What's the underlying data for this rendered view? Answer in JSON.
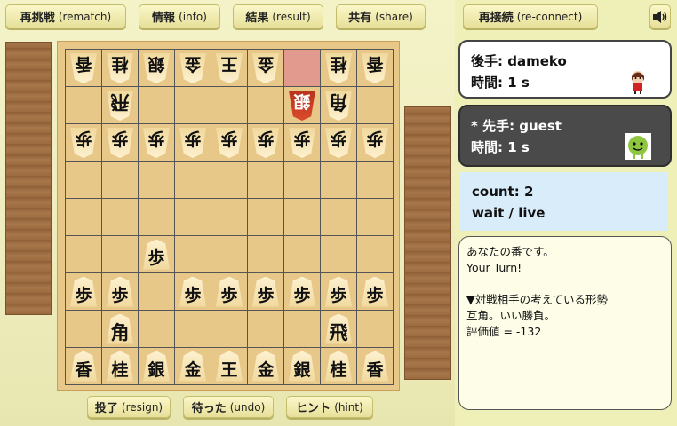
{
  "top_buttons": [
    {
      "jp": "再挑戦",
      "en": "(rematch)"
    },
    {
      "jp": "情報",
      "en": "(info)"
    },
    {
      "jp": "結果",
      "en": "(result)"
    },
    {
      "jp": "共有",
      "en": "(share)"
    },
    {
      "jp": "再接続",
      "en": "(re-connect)"
    }
  ],
  "bottom_buttons": [
    {
      "jp": "投了",
      "en": "(resign)"
    },
    {
      "jp": "待った",
      "en": "(undo)"
    },
    {
      "jp": "ヒント",
      "en": "(hint)"
    }
  ],
  "board": {
    "rows": [
      [
        "香",
        "桂",
        "銀",
        "金",
        "王",
        "金",
        "",
        "桂",
        "香"
      ],
      [
        "",
        "飛",
        "",
        "",
        "",
        "",
        "銀",
        "角",
        ""
      ],
      [
        "歩",
        "歩",
        "歩",
        "歩",
        "歩",
        "歩",
        "歩",
        "歩",
        "歩"
      ],
      [
        "",
        "",
        "",
        "",
        "",
        "",
        "",
        "",
        ""
      ],
      [
        "",
        "",
        "",
        "",
        "",
        "",
        "",
        "",
        ""
      ],
      [
        "",
        "",
        "歩",
        "",
        "",
        "",
        "",
        "",
        ""
      ],
      [
        "歩",
        "歩",
        "",
        "歩",
        "歩",
        "歩",
        "歩",
        "歩",
        "歩"
      ],
      [
        "",
        "角",
        "",
        "",
        "",
        "",
        "",
        "飛",
        ""
      ],
      [
        "香",
        "桂",
        "銀",
        "金",
        "王",
        "金",
        "銀",
        "桂",
        "香"
      ]
    ],
    "owner_top_rows": "gote",
    "highlight_cell": {
      "row": 0,
      "col": 6
    },
    "last_move_piece": {
      "row": 1,
      "col": 6
    }
  },
  "players": {
    "gote": {
      "label": "後手: dameko",
      "time": "時間: 1 s",
      "avatar": "girl-avatar-icon"
    },
    "sente": {
      "label": "* 先手: guest",
      "time": "時間: 1 s",
      "avatar": "green-creature-avatar-icon"
    }
  },
  "status": {
    "count": "count: 2",
    "mode": "wait / live"
  },
  "messages": [
    "あなたの番です。",
    "Your Turn!",
    "",
    "▼対戦相手の考えている形勢",
    "互角。いい勝負。",
    "評価値 = -132"
  ],
  "icons": {
    "sound": "speaker-icon"
  },
  "colors": {
    "highlight": "#e39a8e",
    "last_move": "#c63a20"
  }
}
